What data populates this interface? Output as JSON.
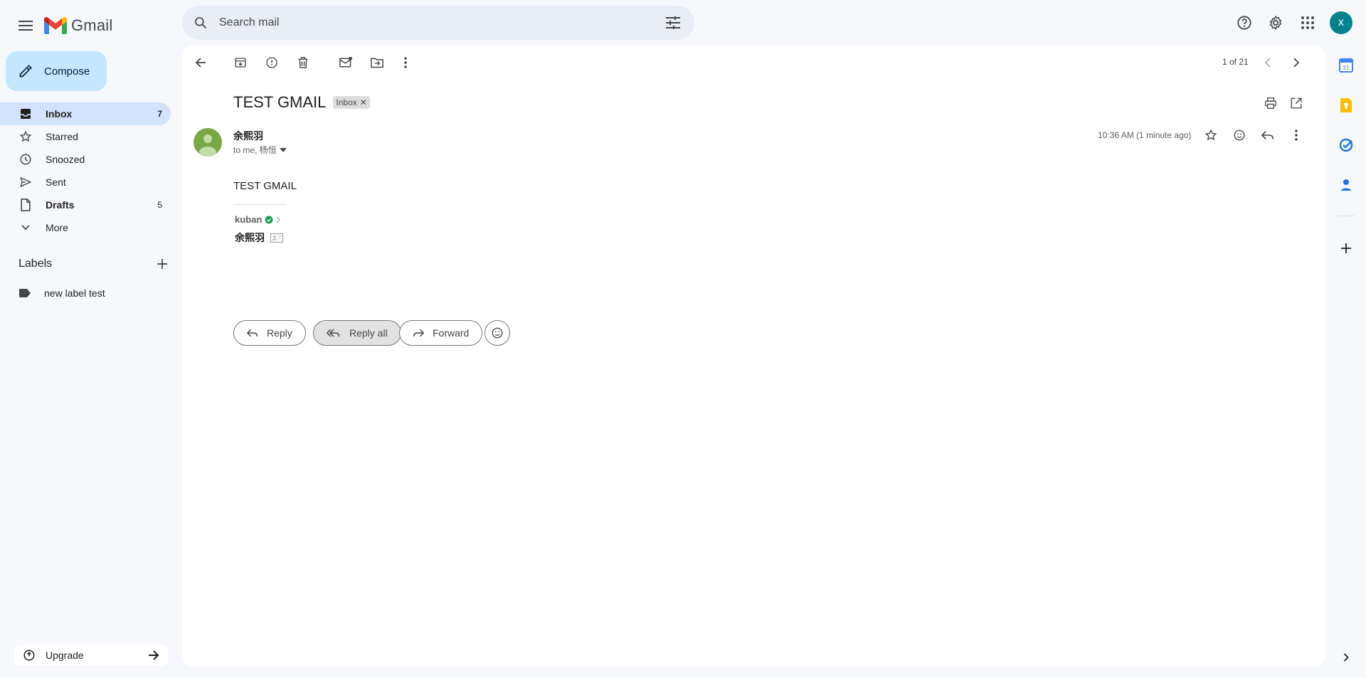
{
  "app": {
    "name": "Gmail"
  },
  "search": {
    "placeholder": "Search mail"
  },
  "header": {
    "avatar_letter": "x"
  },
  "compose": {
    "label": "Compose"
  },
  "nav": {
    "items": [
      {
        "label": "Inbox",
        "count": "7"
      },
      {
        "label": "Starred",
        "count": ""
      },
      {
        "label": "Snoozed",
        "count": ""
      },
      {
        "label": "Sent",
        "count": ""
      },
      {
        "label": "Drafts",
        "count": "5"
      },
      {
        "label": "More",
        "count": ""
      }
    ]
  },
  "labels": {
    "title": "Labels",
    "items": [
      {
        "label": "new label test"
      }
    ]
  },
  "upgrade": {
    "label": "Upgrade"
  },
  "toolbar": {
    "pager": "1 of 21"
  },
  "email": {
    "subject": "TEST GMAIL",
    "tag": "Inbox",
    "sender_name": "余熙羽",
    "recipients": "to me, 杨恒",
    "time": "10:36 AM (1 minute ago)",
    "body": "TEST GMAIL",
    "signature_company": "kuban",
    "signature_name": "余熙羽"
  },
  "actions": {
    "reply": "Reply",
    "reply_all": "Reply all",
    "forward": "Forward"
  },
  "colors": {
    "compose_bg": "#c2e7ff",
    "active_nav": "#d3e3fd",
    "avatar": "#00838f",
    "sender_avatar": "#78a844"
  }
}
